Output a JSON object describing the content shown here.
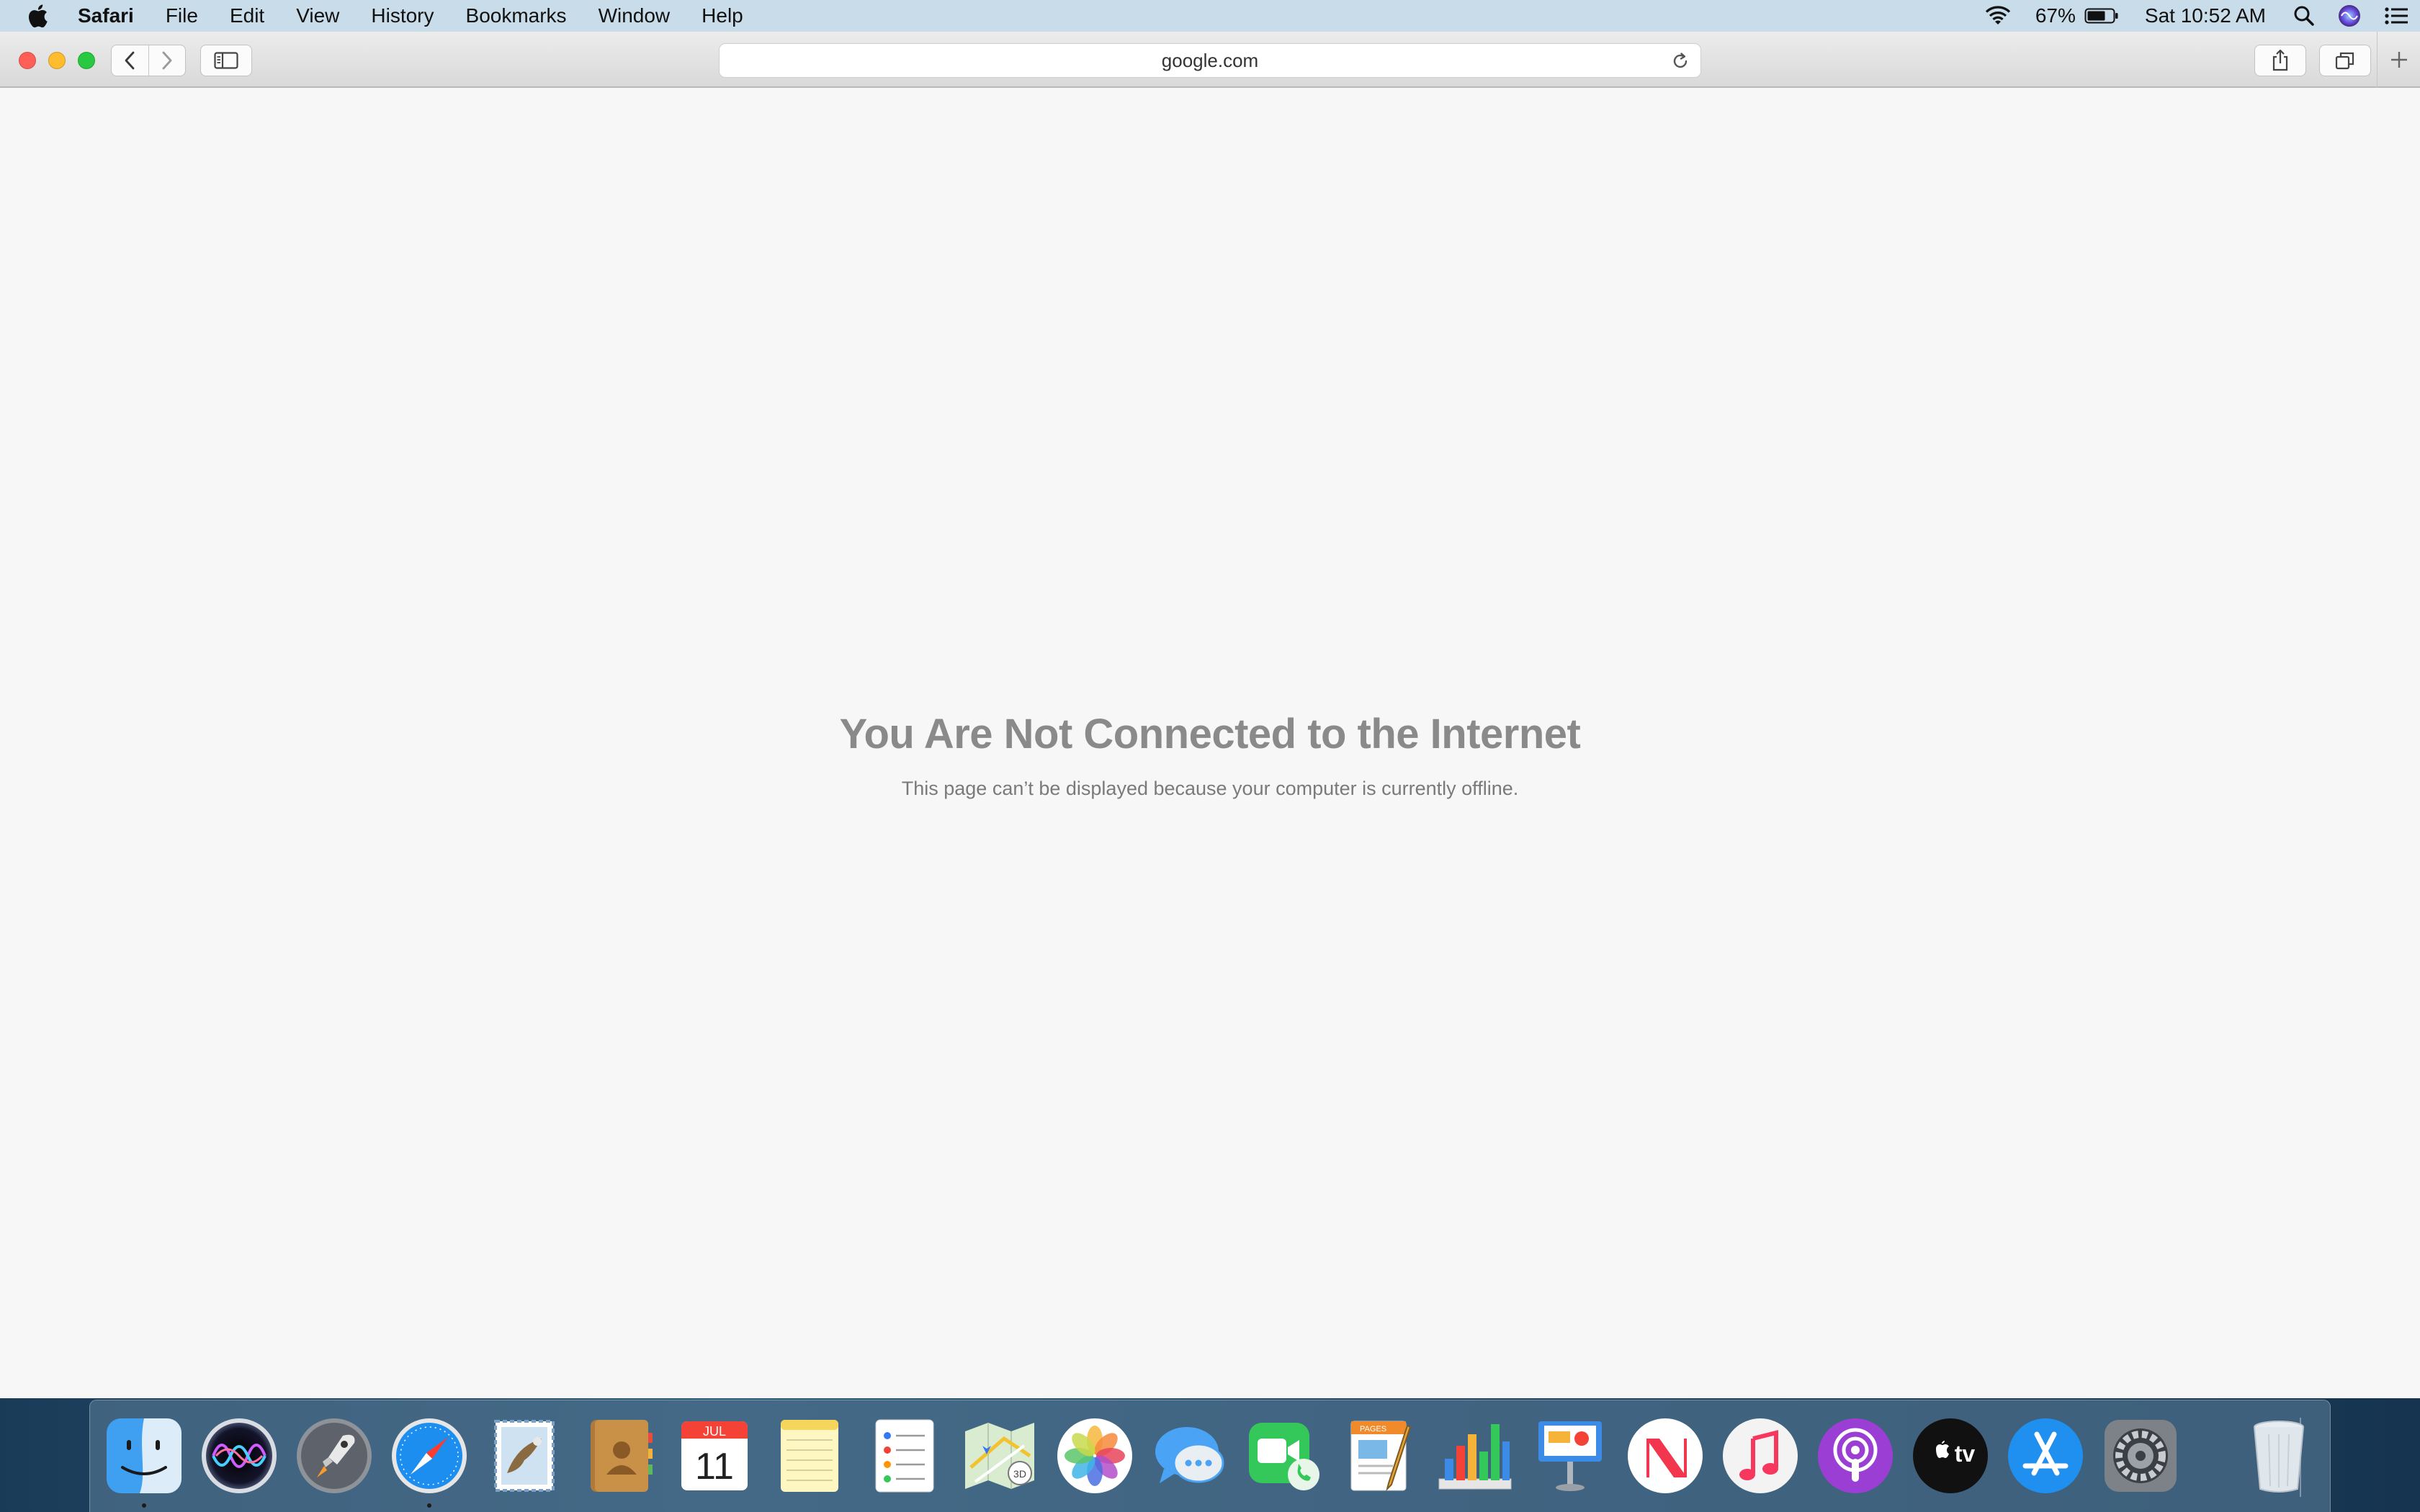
{
  "menubar": {
    "app_name": "Safari",
    "items": [
      "File",
      "Edit",
      "View",
      "History",
      "Bookmarks",
      "Window",
      "Help"
    ],
    "battery_percent": "67%",
    "clock": "Sat 10:52 AM"
  },
  "browser": {
    "address": "google.com"
  },
  "page": {
    "error_title": "You Are Not Connected to the Internet",
    "error_message": "This page can’t be displayed because your computer is currently offline."
  },
  "dock": {
    "apps": [
      "Finder",
      "Siri",
      "Launchpad",
      "Safari",
      "Mail",
      "Contacts",
      "Calendar",
      "Notes",
      "Reminders",
      "Maps",
      "Photos",
      "Messages",
      "FaceTime",
      "Pages",
      "Numbers",
      "Keynote",
      "News",
      "Music",
      "Podcasts",
      "TV",
      "App Store",
      "System Preferences",
      "Trash"
    ],
    "calendar_month": "JUL",
    "calendar_day": "11",
    "tv_label": "tv"
  },
  "colors": {
    "close": "#ff5f57",
    "minimize": "#febc2e",
    "zoom": "#28c840",
    "menubar": "#c9dcea",
    "page_bg": "#f7f7f7"
  }
}
